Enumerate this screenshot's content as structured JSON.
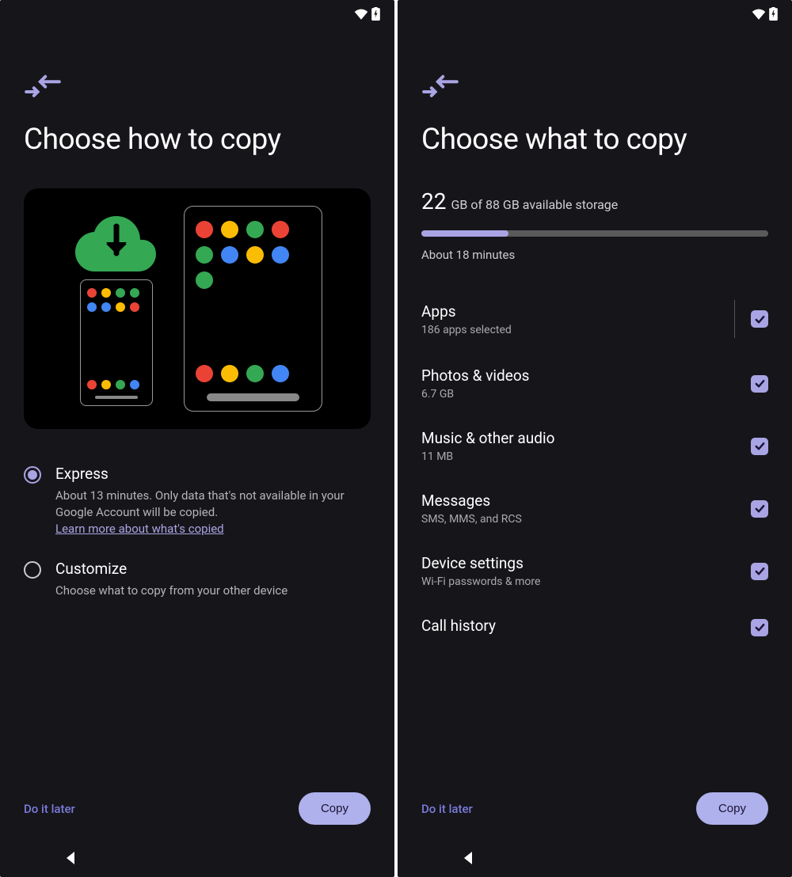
{
  "left": {
    "title": "Choose how to copy",
    "options": {
      "express": {
        "title": "Express",
        "desc_line1": "About 13 minutes. Only data that's not available in your Google Account will be copied.",
        "learn_more": "Learn more about what's copied",
        "selected": true
      },
      "customize": {
        "title": "Customize",
        "desc": "Choose what to copy from your other device",
        "selected": false
      }
    },
    "footer": {
      "later": "Do it later",
      "action": "Copy"
    }
  },
  "right": {
    "title": "Choose what to copy",
    "storage": {
      "used": "22",
      "units_line": "GB of 88 GB available storage",
      "progress_pct": 25,
      "time": "About 18 minutes"
    },
    "items": [
      {
        "title": "Apps",
        "sub": "186 apps selected",
        "checked": true,
        "expandable": true
      },
      {
        "title": "Photos & videos",
        "sub": "6.7 GB",
        "checked": true
      },
      {
        "title": "Music & other audio",
        "sub": "11 MB",
        "checked": true
      },
      {
        "title": "Messages",
        "sub": "SMS, MMS, and RCS",
        "checked": true
      },
      {
        "title": "Device settings",
        "sub": "Wi-Fi passwords & more",
        "checked": true
      },
      {
        "title": "Call history",
        "sub": "",
        "checked": true
      }
    ],
    "footer": {
      "later": "Do it later",
      "action": "Copy"
    }
  }
}
